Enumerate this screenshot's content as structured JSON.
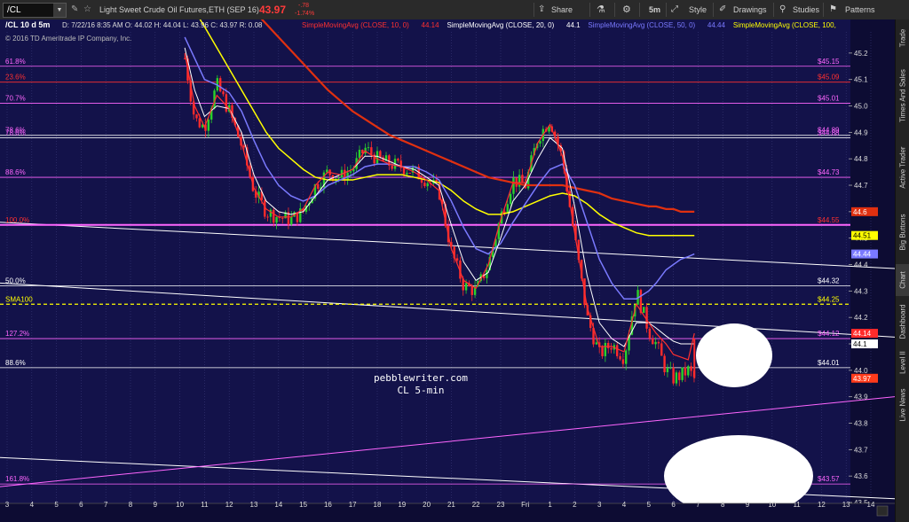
{
  "toolbar": {
    "symbol": "/CL",
    "instrument_name": "Light Sweet Crude Oil Futures,ETH (SEP 16)",
    "last_price": "43.97",
    "change": "-.78",
    "change_pct": "-1.74%",
    "share_label": "Share",
    "interval_label": "5m",
    "style_label": "Style",
    "drawings_label": "Drawings",
    "studies_label": "Studies",
    "patterns_label": "Patterns"
  },
  "sidebar": {
    "tabs": [
      "Trade",
      "Times And Sales",
      "Active Trader",
      "Big Buttons",
      "Chart",
      "Dashboard",
      "Level II",
      "Live News"
    ],
    "active": "Chart"
  },
  "chart_data": {
    "type": "line",
    "header_text": "/CL 10 d 5m",
    "ohlc_text": "D: 7/22/16 8:35 AM   O: 44.02   H: 44.04   L: 43.96   C: 43.97   R: 0.08",
    "studies_header": [
      {
        "text": "SimpleMovingAvg (CLOSE, 10, 0)",
        "value": "44.14",
        "color": "#ff3030"
      },
      {
        "text": "SimpleMovingAvg (CLOSE, 20, 0)",
        "value": "44.1",
        "color": "#ffffff"
      },
      {
        "text": "SimpleMovingAvg (CLOSE, 50, 0)",
        "value": "44.44",
        "color": "#7a7aff"
      },
      {
        "text": "SimpleMovingAvg (CLOSE, 100,",
        "value": "",
        "color": "#ffff00"
      }
    ],
    "copyright": "© 2016 TD Ameritrade IP Company, Inc.",
    "watermark": [
      "pebblewriter.com",
      "CL 5-min"
    ],
    "colors": {
      "background": "#13124a",
      "grid": "#3a3a78",
      "up": "#2bd12b",
      "down": "#ff2b2b",
      "fib": "#ff66ff",
      "fib_white": "#ffffff",
      "sma10": "#ff3030",
      "sma20": "#ffffff",
      "sma50": "#7a7aff",
      "sma100": "#ffff00",
      "sma200": "#e03010"
    },
    "y_axis": {
      "ylim": [
        43.5,
        45.28
      ],
      "ticks": [
        45.2,
        45.1,
        45.0,
        44.9,
        44.8,
        44.7,
        44.6,
        44.5,
        44.4,
        44.3,
        44.2,
        44.1,
        44.0,
        43.9,
        43.8,
        43.7,
        43.6,
        43.5
      ]
    },
    "x_axis": {
      "labels": [
        "3",
        "4",
        "5",
        "6",
        "7",
        "8",
        "9",
        "10",
        "11",
        "12",
        "13",
        "14",
        "15",
        "16",
        "17",
        "18",
        "19",
        "20",
        "21",
        "22",
        "23",
        "Fri",
        "1",
        "2",
        "3",
        "4",
        "5",
        "6",
        "7",
        "8",
        "9",
        "10",
        "11",
        "12",
        "13",
        "14"
      ],
      "last_bar_index": 27.85
    },
    "fib_levels": [
      {
        "label": "61.8%",
        "value": 45.15,
        "value_label": "$45.15",
        "color": "#ff66ff",
        "label_color": "#ff66ff"
      },
      {
        "label": "23.6%",
        "value": 45.09,
        "value_label": "$45.09",
        "color": "#ff3030",
        "label_color": "#ff3030"
      },
      {
        "label": "70.7%",
        "value": 45.01,
        "value_label": "$45.01",
        "color": "#ff66ff",
        "label_color": "#ff66ff"
      },
      {
        "label": "78.6%",
        "value": 44.89,
        "value_label": "$44.89",
        "color": "#ffffff",
        "label_color": "#ff66ff"
      },
      {
        "label": "78.6%",
        "value": 44.88,
        "value_label": "$44.88",
        "color": "#ffffff",
        "label_color": "#ff66ff"
      },
      {
        "label": "88.6%",
        "value": 44.73,
        "value_label": "$44.73",
        "color": "#ff66ff",
        "label_color": "#ff66ff"
      },
      {
        "label": "100.0%",
        "value": 44.55,
        "value_label": "$44.55",
        "color": "#ff66ff",
        "label_color": "#ff3030"
      },
      {
        "label": "50.0%",
        "value": 44.32,
        "value_label": "$44.32",
        "color": "#ffffff",
        "label_color": "#ffffff"
      },
      {
        "label": "127.2%",
        "value": 44.12,
        "value_label": "$44.12",
        "color": "#ff66ff",
        "label_color": "#ff66ff"
      },
      {
        "label": "88.6%",
        "value": 44.01,
        "value_label": "$44.01",
        "color": "#ffffff",
        "label_color": "#ffffff"
      },
      {
        "label": "161.8%",
        "value": 43.57,
        "value_label": "$43.57",
        "color": "#ff66ff",
        "label_color": "#ff66ff"
      }
    ],
    "sma100_line": {
      "label": "SMA100",
      "value": 44.25,
      "value_label": "$44.25",
      "color": "#ffff00"
    },
    "trendlines": [
      {
        "color": "#ffffff",
        "x": [
          -0.3,
          37
        ],
        "y": [
          44.56,
          44.38
        ]
      },
      {
        "color": "#ffffff",
        "x": [
          -0.3,
          37
        ],
        "y": [
          44.33,
          44.12
        ]
      },
      {
        "color": "#ffffff",
        "x": [
          -0.3,
          37
        ],
        "y": [
          43.67,
          43.51
        ]
      },
      {
        "color": "#ff66ff",
        "x": [
          -0.3,
          37
        ],
        "y": [
          43.56,
          43.91
        ]
      }
    ],
    "price_tags": [
      {
        "value": 44.6,
        "label": "44.6",
        "bg": "#e03010",
        "fg": "#ffffff"
      },
      {
        "value": 44.51,
        "label": "44.51",
        "bg": "#ffff00",
        "fg": "#000000"
      },
      {
        "value": 44.44,
        "label": "44.44",
        "bg": "#7a7aff",
        "fg": "#ffffff"
      },
      {
        "value": 44.14,
        "label": "44.14",
        "bg": "#ff2b2b",
        "fg": "#ffffff"
      },
      {
        "value": 44.1,
        "label": "44.1",
        "bg": "#ffffff",
        "fg": "#000000"
      },
      {
        "value": 43.97,
        "label": "43.97",
        "bg": "#ff3b1b",
        "fg": "#ffffff"
      }
    ],
    "close_path": {
      "x": [
        7.2,
        7.6,
        8.0,
        8.5,
        9.0,
        9.5,
        10.0,
        10.5,
        11.0,
        11.5,
        12.0,
        12.5,
        13.0,
        13.5,
        14.0,
        14.5,
        15.0,
        15.5,
        16.0,
        16.5,
        17.0,
        17.5,
        18.0,
        18.5,
        19.0,
        19.5,
        20.0,
        20.5,
        21.0,
        21.5,
        22.0,
        22.5,
        23.0,
        23.5,
        24.0,
        24.5,
        25.0,
        25.5,
        26.0,
        26.3,
        26.7,
        27.0,
        27.3,
        27.6,
        27.85
      ],
      "y": [
        45.18,
        44.95,
        44.92,
        45.08,
        44.98,
        44.85,
        44.68,
        44.6,
        44.58,
        44.57,
        44.6,
        44.7,
        44.75,
        44.73,
        44.76,
        44.84,
        44.8,
        44.78,
        44.77,
        44.75,
        44.72,
        44.68,
        44.45,
        44.32,
        44.3,
        44.4,
        44.58,
        44.72,
        44.7,
        44.88,
        44.95,
        44.8,
        44.5,
        44.2,
        44.06,
        44.1,
        44.05,
        44.3,
        44.15,
        44.1,
        44.0,
        43.97,
        43.98,
        44.0,
        43.97
      ]
    },
    "sma10": {
      "x": [
        7.2,
        7.6,
        8.0,
        8.5,
        9.0,
        9.5,
        10.0,
        10.5,
        11.0,
        11.5,
        12.0,
        12.5,
        13.0,
        13.5,
        14.0,
        14.5,
        15.0,
        15.5,
        16.0,
        16.5,
        17.0,
        17.5,
        18.0,
        18.5,
        19.0,
        19.5,
        20.0,
        20.5,
        21.0,
        21.5,
        22.0,
        22.5,
        23.0,
        23.5,
        24.0,
        24.5,
        25.0,
        25.5,
        26.0,
        26.3,
        26.7,
        27.0,
        27.3,
        27.6,
        27.85
      ],
      "y": [
        45.2,
        45.0,
        44.92,
        45.04,
        44.99,
        44.86,
        44.69,
        44.61,
        44.58,
        44.58,
        44.61,
        44.7,
        44.75,
        44.74,
        44.76,
        44.83,
        44.8,
        44.78,
        44.77,
        44.75,
        44.72,
        44.68,
        44.46,
        44.34,
        44.31,
        44.4,
        44.57,
        44.71,
        44.71,
        44.86,
        44.93,
        44.81,
        44.52,
        44.24,
        44.09,
        44.09,
        44.07,
        44.25,
        44.18,
        44.14,
        44.1,
        44.06,
        44.05,
        44.04,
        44.14
      ]
    },
    "sma20": {
      "x": [
        7.2,
        7.6,
        8.0,
        8.5,
        9.0,
        9.5,
        10.0,
        10.5,
        11.0,
        11.5,
        12.0,
        12.5,
        13.0,
        13.5,
        14.0,
        14.5,
        15.0,
        15.5,
        16.0,
        16.5,
        17.0,
        17.5,
        18.0,
        18.5,
        19.0,
        19.5,
        20.0,
        20.5,
        21.0,
        21.5,
        22.0,
        22.5,
        23.0,
        23.5,
        24.0,
        24.5,
        25.0,
        25.5,
        26.0,
        26.3,
        26.7,
        27.0,
        27.3,
        27.6,
        27.85
      ],
      "y": [
        45.22,
        45.06,
        44.96,
        45.0,
        44.99,
        44.9,
        44.74,
        44.64,
        44.6,
        44.59,
        44.6,
        44.66,
        44.72,
        44.74,
        44.76,
        44.81,
        44.81,
        44.79,
        44.77,
        44.76,
        44.73,
        44.7,
        44.55,
        44.41,
        44.34,
        44.37,
        44.5,
        44.64,
        44.7,
        44.8,
        44.88,
        44.84,
        44.62,
        44.36,
        44.18,
        44.12,
        44.09,
        44.18,
        44.18,
        44.16,
        44.13,
        44.11,
        44.1,
        44.1,
        44.1
      ]
    },
    "sma50": {
      "x": [
        7.2,
        7.6,
        8.0,
        8.5,
        9.0,
        9.5,
        10.0,
        10.5,
        11.0,
        11.5,
        12.0,
        12.5,
        13.0,
        13.5,
        14.0,
        14.5,
        15.0,
        15.5,
        16.0,
        16.5,
        17.0,
        17.5,
        18.0,
        18.5,
        19.0,
        19.5,
        20.0,
        20.5,
        21.0,
        21.5,
        22.0,
        22.5,
        23.0,
        23.5,
        24.0,
        24.5,
        25.0,
        25.5,
        26.0,
        26.3,
        26.7,
        27.0,
        27.3,
        27.6,
        27.85
      ],
      "y": [
        45.26,
        45.18,
        45.1,
        45.08,
        45.05,
        44.98,
        44.87,
        44.77,
        44.7,
        44.66,
        44.64,
        44.66,
        44.7,
        44.72,
        44.74,
        44.77,
        44.78,
        44.78,
        44.77,
        44.77,
        44.75,
        44.72,
        44.64,
        44.54,
        44.46,
        44.44,
        44.48,
        44.56,
        44.63,
        44.7,
        44.76,
        44.78,
        44.7,
        44.56,
        44.42,
        44.33,
        44.27,
        44.27,
        44.3,
        44.33,
        44.38,
        44.4,
        44.42,
        44.43,
        44.44
      ]
    },
    "sma100": {
      "x": [
        7.2,
        7.6,
        8.0,
        8.5,
        9.0,
        9.5,
        10.0,
        10.5,
        11.0,
        11.5,
        12.0,
        12.5,
        13.0,
        13.5,
        14.0,
        14.5,
        15.0,
        15.5,
        16.0,
        16.5,
        17.0,
        17.5,
        18.0,
        18.5,
        19.0,
        19.5,
        20.0,
        20.5,
        21.0,
        21.5,
        22.0,
        22.5,
        23.0,
        23.5,
        24.0,
        24.5,
        25.0,
        25.5,
        26.0,
        26.3,
        26.7,
        27.0,
        27.3,
        27.6,
        27.85
      ],
      "y": [
        45.42,
        45.36,
        45.3,
        45.22,
        45.14,
        45.06,
        44.98,
        44.9,
        44.84,
        44.8,
        44.76,
        44.73,
        44.72,
        44.72,
        44.72,
        44.73,
        44.74,
        44.74,
        44.74,
        44.73,
        44.72,
        44.71,
        44.68,
        44.64,
        44.61,
        44.59,
        44.59,
        44.6,
        44.62,
        44.64,
        44.66,
        44.67,
        44.66,
        44.63,
        44.59,
        44.56,
        44.54,
        44.52,
        44.51,
        44.51,
        44.51,
        44.51,
        44.51,
        44.51,
        44.51
      ]
    },
    "sma200": {
      "x": [
        7.2,
        7.6,
        8.0,
        8.5,
        9.0,
        9.5,
        10.0,
        10.5,
        11.0,
        11.5,
        12.0,
        12.5,
        13.0,
        13.5,
        14.0,
        14.5,
        15.0,
        15.5,
        16.0,
        16.5,
        17.0,
        17.5,
        18.0,
        18.5,
        19.0,
        19.5,
        20.0,
        20.5,
        21.0,
        21.5,
        22.0,
        22.5,
        23.0,
        23.5,
        24.0,
        24.5,
        25.0,
        25.5,
        26.0,
        26.3,
        26.7,
        27.0,
        27.3,
        27.6,
        27.85
      ],
      "y": [
        45.6,
        45.56,
        45.52,
        45.48,
        45.44,
        45.4,
        45.36,
        45.31,
        45.26,
        45.21,
        45.16,
        45.11,
        45.06,
        45.02,
        44.98,
        44.95,
        44.92,
        44.89,
        44.87,
        44.85,
        44.83,
        44.81,
        44.79,
        44.77,
        44.75,
        44.73,
        44.72,
        44.71,
        44.7,
        44.7,
        44.7,
        44.7,
        44.69,
        44.68,
        44.67,
        44.65,
        44.64,
        44.63,
        44.62,
        44.62,
        44.61,
        44.61,
        44.6,
        44.6,
        44.6
      ]
    }
  }
}
